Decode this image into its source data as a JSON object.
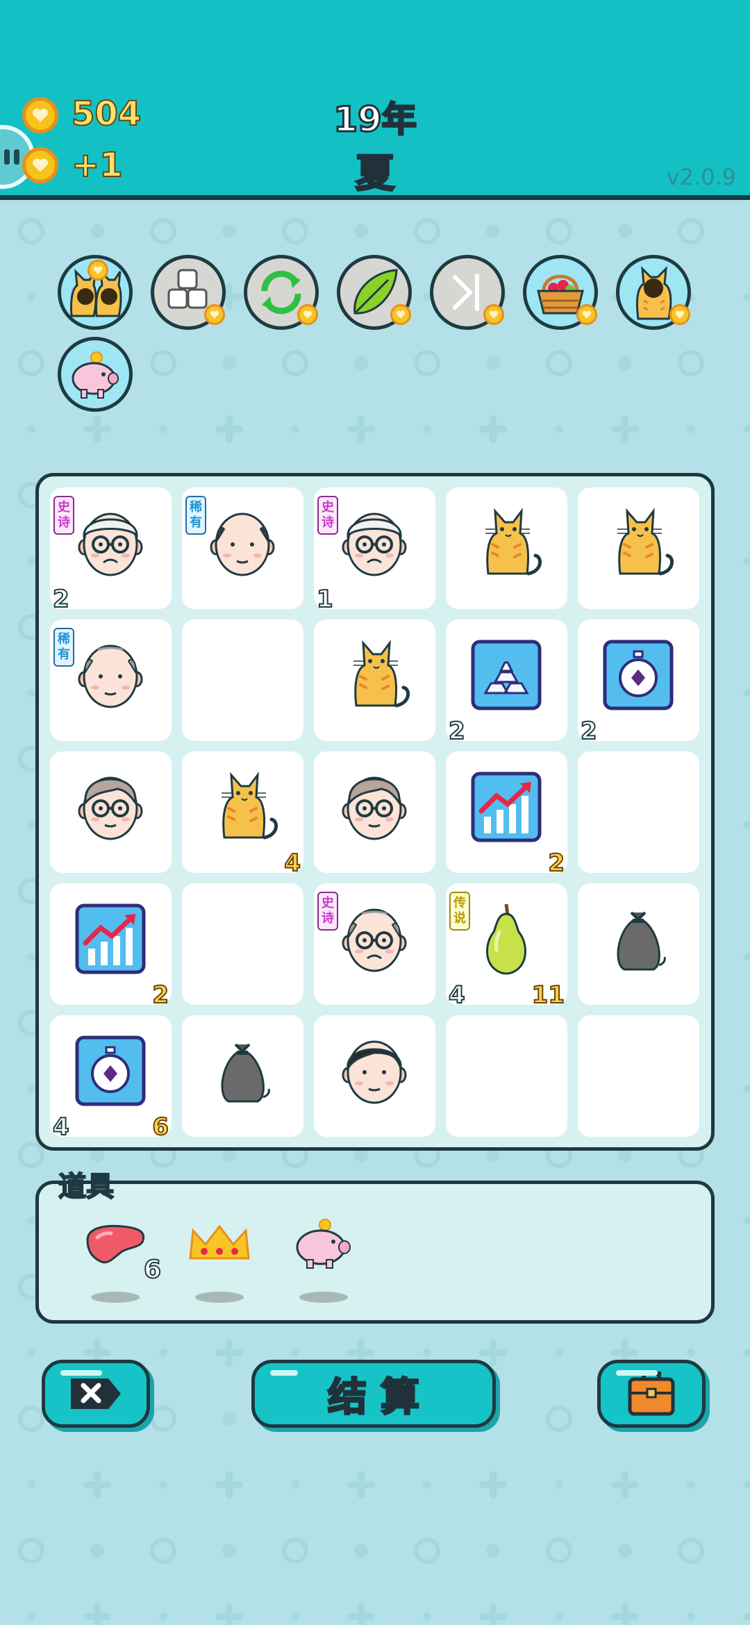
{
  "header": {
    "coins": "504",
    "coin_delta": "+1",
    "year": "19年",
    "season": "夏",
    "version": "v2.0.9"
  },
  "skills": [
    {
      "name": "cat-pair-icon",
      "active": true
    },
    {
      "name": "blocks-icon",
      "active": false
    },
    {
      "name": "refresh-icon",
      "active": false
    },
    {
      "name": "leaf-icon",
      "active": false
    },
    {
      "name": "skip-icon",
      "active": false
    },
    {
      "name": "fruit-basket-icon",
      "active": true
    },
    {
      "name": "cat-icon",
      "active": true
    },
    {
      "name": "piggy-bank-icon",
      "active": true
    }
  ],
  "board": {
    "rows": [
      [
        {
          "item": "old-man-glasses-white",
          "tag": "史诗",
          "tag_type": "epic",
          "left": "2",
          "right": ""
        },
        {
          "item": "bald-man",
          "tag": "稀有",
          "tag_type": "rare",
          "left": "",
          "right": ""
        },
        {
          "item": "old-man-glasses-white",
          "tag": "史诗",
          "tag_type": "epic",
          "left": "1",
          "right": ""
        },
        {
          "item": "cat",
          "tag": "",
          "tag_type": "",
          "left": "",
          "right": ""
        },
        {
          "item": "cat",
          "tag": "",
          "tag_type": "",
          "left": "",
          "right": ""
        }
      ],
      [
        {
          "item": "bald-old-man",
          "tag": "稀有",
          "tag_type": "rare",
          "left": "",
          "right": ""
        },
        {
          "item": "empty",
          "tag": "",
          "tag_type": "",
          "left": "",
          "right": ""
        },
        {
          "item": "cat",
          "tag": "",
          "tag_type": "",
          "left": "",
          "right": ""
        },
        {
          "item": "gold-bars",
          "tag": "",
          "tag_type": "",
          "left": "2",
          "right": ""
        },
        {
          "item": "stopwatch",
          "tag": "",
          "tag_type": "",
          "left": "2",
          "right": ""
        }
      ],
      [
        {
          "item": "old-man-glasses",
          "tag": "",
          "tag_type": "",
          "left": "",
          "right": ""
        },
        {
          "item": "cat",
          "tag": "",
          "tag_type": "",
          "left": "",
          "right": "4"
        },
        {
          "item": "old-man-glasses",
          "tag": "",
          "tag_type": "",
          "left": "",
          "right": ""
        },
        {
          "item": "growth-chart",
          "tag": "",
          "tag_type": "",
          "left": "",
          "right": "2"
        },
        {
          "item": "empty",
          "tag": "",
          "tag_type": "",
          "left": "",
          "right": ""
        }
      ],
      [
        {
          "item": "growth-chart",
          "tag": "",
          "tag_type": "",
          "left": "",
          "right": "2"
        },
        {
          "item": "empty",
          "tag": "",
          "tag_type": "",
          "left": "",
          "right": ""
        },
        {
          "item": "old-man-frown",
          "tag": "史诗",
          "tag_type": "epic",
          "left": "",
          "right": ""
        },
        {
          "item": "pear",
          "tag": "传说",
          "tag_type": "legend",
          "left": "4",
          "right": "11"
        },
        {
          "item": "trash-bag",
          "tag": "",
          "tag_type": "",
          "left": "",
          "right": ""
        }
      ],
      [
        {
          "item": "stopwatch",
          "tag": "",
          "tag_type": "",
          "left": "4",
          "right": "6"
        },
        {
          "item": "trash-bag",
          "tag": "",
          "tag_type": "",
          "left": "",
          "right": ""
        },
        {
          "item": "young-man",
          "tag": "",
          "tag_type": "",
          "left": "",
          "right": ""
        },
        {
          "item": "empty",
          "tag": "",
          "tag_type": "",
          "left": "",
          "right": ""
        },
        {
          "item": "empty",
          "tag": "",
          "tag_type": "",
          "left": "",
          "right": ""
        }
      ]
    ]
  },
  "items": {
    "label": "道具",
    "list": [
      {
        "name": "liver-icon",
        "qty": "6"
      },
      {
        "name": "crown-icon",
        "qty": ""
      },
      {
        "name": "piggy-bank-icon",
        "qty": ""
      }
    ]
  },
  "buttons": {
    "settle_label": "结算"
  }
}
